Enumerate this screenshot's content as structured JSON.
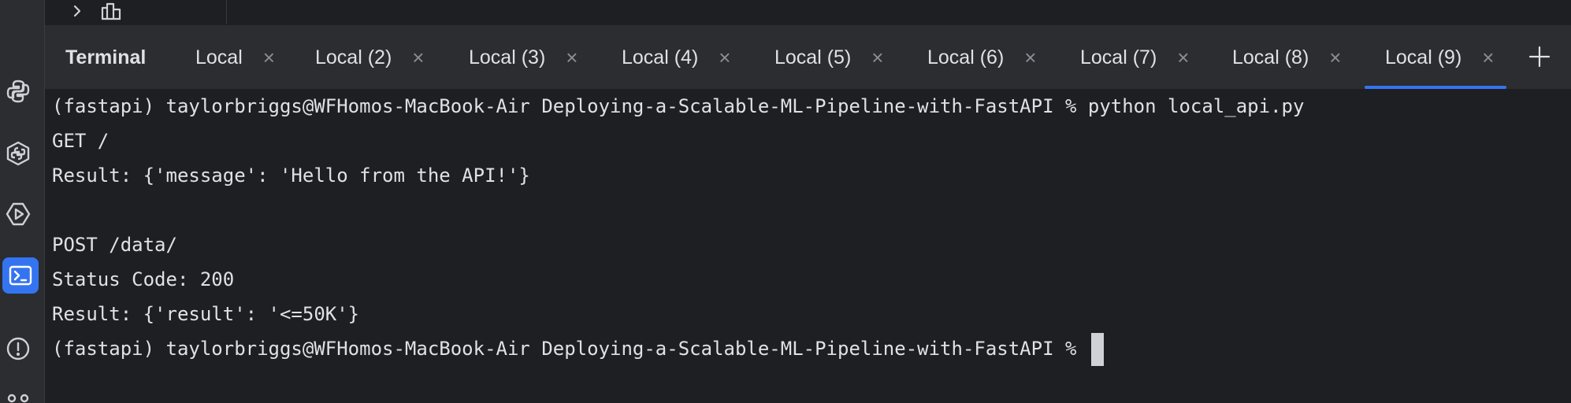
{
  "terminal_panel": {
    "title": "Terminal",
    "tabs": [
      {
        "label": "Local",
        "active": false
      },
      {
        "label": "Local (2)",
        "active": false
      },
      {
        "label": "Local (3)",
        "active": false
      },
      {
        "label": "Local (4)",
        "active": false
      },
      {
        "label": "Local (5)",
        "active": false
      },
      {
        "label": "Local (6)",
        "active": false
      },
      {
        "label": "Local (7)",
        "active": false
      },
      {
        "label": "Local (8)",
        "active": false
      },
      {
        "label": "Local (9)",
        "active": true
      }
    ],
    "close_glyph": "×",
    "add_tab_icon": "plus-icon"
  },
  "output": {
    "lines": [
      "(fastapi) taylorbriggs@WFHomos-MacBook-Air Deploying-a-Scalable-ML-Pipeline-with-FastAPI % python local_api.py",
      "GET /",
      "Result: {'message': 'Hello from the API!'}",
      "",
      "POST /data/",
      "Status Code: 200",
      "Result: {'result': '<=50K'}"
    ],
    "prompt": "(fastapi) taylorbriggs@WFHomos-MacBook-Air Deploying-a-Scalable-ML-Pipeline-with-FastAPI % "
  },
  "toolstrip": {
    "icons": [
      "python-packages-icon",
      "python-console-icon",
      "services-icon",
      "terminal-icon",
      "problems-icon",
      "version-control-icon"
    ],
    "active": "terminal-icon"
  },
  "colors": {
    "background": "#1e1f22",
    "tabbar": "#2b2d30",
    "accent": "#3574f0",
    "text": "#dfe1e5"
  }
}
